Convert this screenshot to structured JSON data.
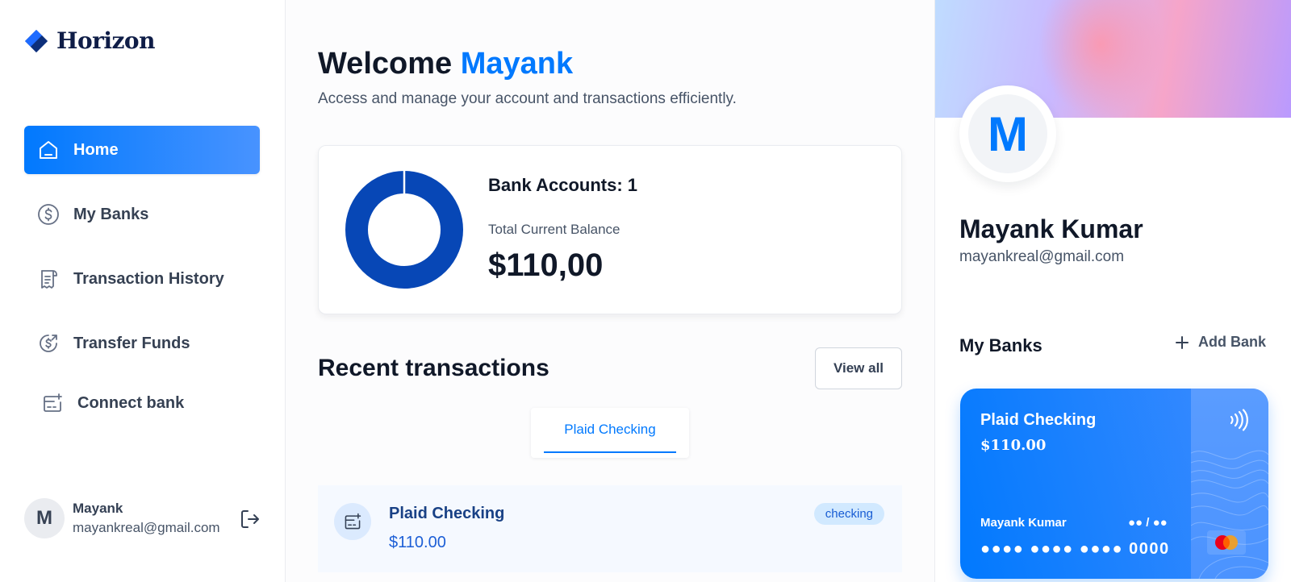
{
  "app": {
    "name": "Horizon"
  },
  "sidebar": {
    "items": [
      {
        "label": "Home",
        "icon": "home-icon",
        "active": true
      },
      {
        "label": "My Banks",
        "icon": "dollar-circle-icon"
      },
      {
        "label": "Transaction History",
        "icon": "receipt-icon"
      },
      {
        "label": "Transfer Funds",
        "icon": "money-send-icon"
      },
      {
        "label": "Connect bank",
        "icon": "connect-bank-icon"
      }
    ],
    "user": {
      "initial": "M",
      "name": "Mayank",
      "email": "mayankreal@gmail.com"
    }
  },
  "header": {
    "greeting": "Welcome",
    "user_first_name": "Mayank",
    "subtitle": "Access and manage your account and transactions efficiently."
  },
  "balance": {
    "accounts_label": "Bank Accounts: 1",
    "total_label": "Total Current Balance",
    "total_amount": "$110,00",
    "chart_color": "#0747b6"
  },
  "recent": {
    "title": "Recent transactions",
    "view_all_label": "View all",
    "tabs": [
      {
        "label": "Plaid Checking",
        "active": true
      }
    ],
    "transactions": [
      {
        "name": "Plaid Checking",
        "amount": "$110.00",
        "badge": "checking"
      }
    ]
  },
  "profile": {
    "initial": "M",
    "name": "Mayank Kumar",
    "email": "mayankreal@gmail.com"
  },
  "my_banks": {
    "title": "My Banks",
    "add_label": "Add Bank",
    "cards": [
      {
        "bank_name": "Plaid Checking",
        "balance": "$110.00",
        "holder": "Mayank Kumar",
        "expiry": "●● / ●●",
        "number": "●●●● ●●●● ●●●● 0000"
      }
    ]
  },
  "colors": {
    "accent": "#0179fe",
    "donut": "#0747b6",
    "text": "#101828"
  }
}
